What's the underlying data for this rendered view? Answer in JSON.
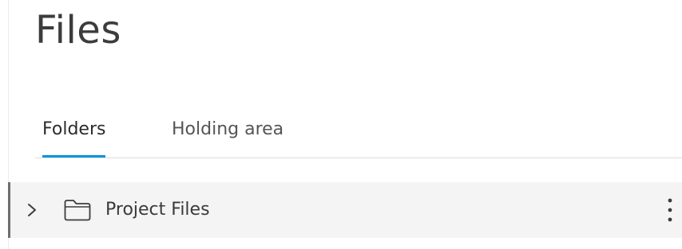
{
  "header": {
    "title": "Files"
  },
  "tabs": [
    {
      "label": "Folders",
      "active": true
    },
    {
      "label": "Holding area",
      "active": false
    }
  ],
  "tree": {
    "items": [
      {
        "label": "Project Files",
        "expanded": false,
        "icon": "folder-icon"
      }
    ]
  },
  "colors": {
    "accent": "#0696d7",
    "row_bg": "#f4f4f4",
    "text": "#3c3c3c"
  }
}
